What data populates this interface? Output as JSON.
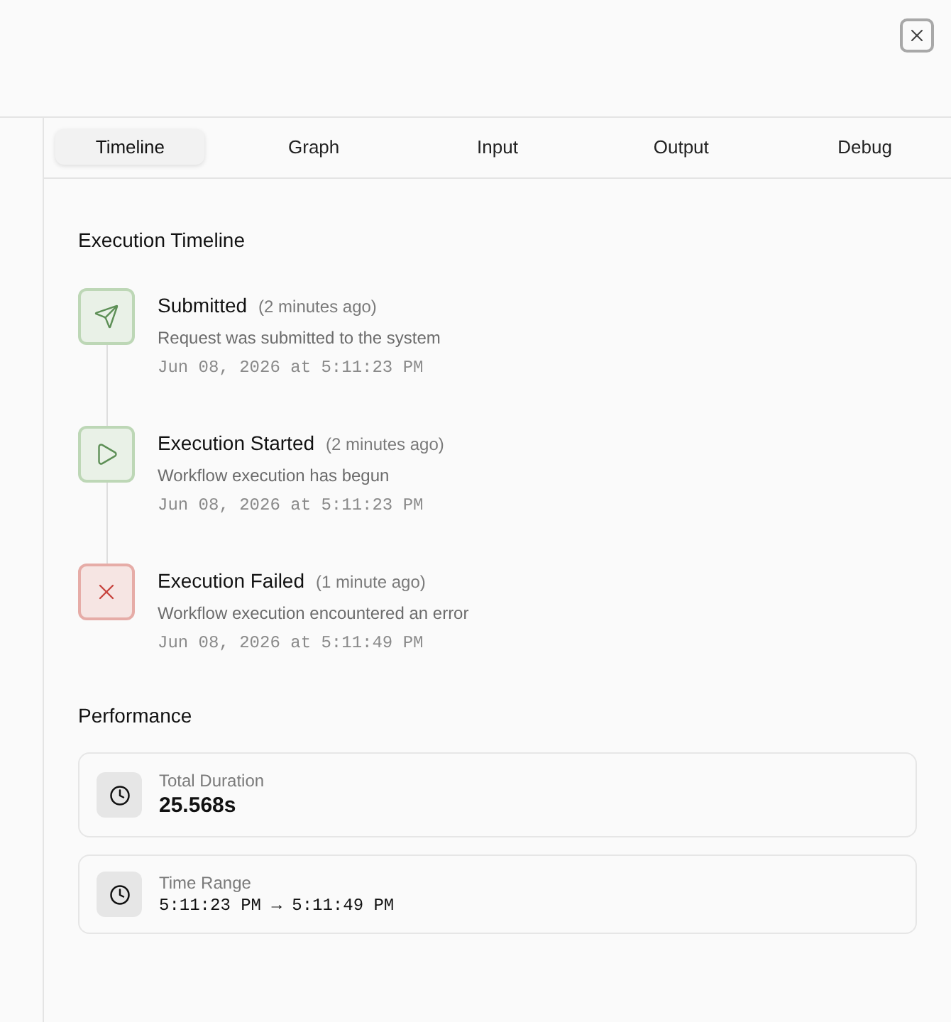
{
  "tabs": [
    {
      "label": "Timeline",
      "selected": true
    },
    {
      "label": "Graph",
      "selected": false
    },
    {
      "label": "Input",
      "selected": false
    },
    {
      "label": "Output",
      "selected": false
    },
    {
      "label": "Debug",
      "selected": false
    }
  ],
  "timeline": {
    "title": "Execution Timeline",
    "events": [
      {
        "kind": "submitted",
        "title": "Submitted",
        "relative_time": "(2 minutes ago)",
        "description": "Request was submitted to the system",
        "timestamp": "Jun 08, 2026 at 5:11:23 PM"
      },
      {
        "kind": "started",
        "title": "Execution Started",
        "relative_time": "(2 minutes ago)",
        "description": "Workflow execution has begun",
        "timestamp": "Jun 08, 2026 at 5:11:23 PM"
      },
      {
        "kind": "failed",
        "title": "Execution Failed",
        "relative_time": "(1 minute ago)",
        "description": "Workflow execution encountered an error",
        "timestamp": "Jun 08, 2026 at 5:11:49 PM"
      }
    ]
  },
  "performance": {
    "title": "Performance",
    "metrics": [
      {
        "kind": "duration",
        "label": "Total Duration",
        "value": "25.568s"
      },
      {
        "kind": "range",
        "label": "Time Range",
        "value": "5:11:23 PM → 5:11:49 PM"
      }
    ]
  }
}
